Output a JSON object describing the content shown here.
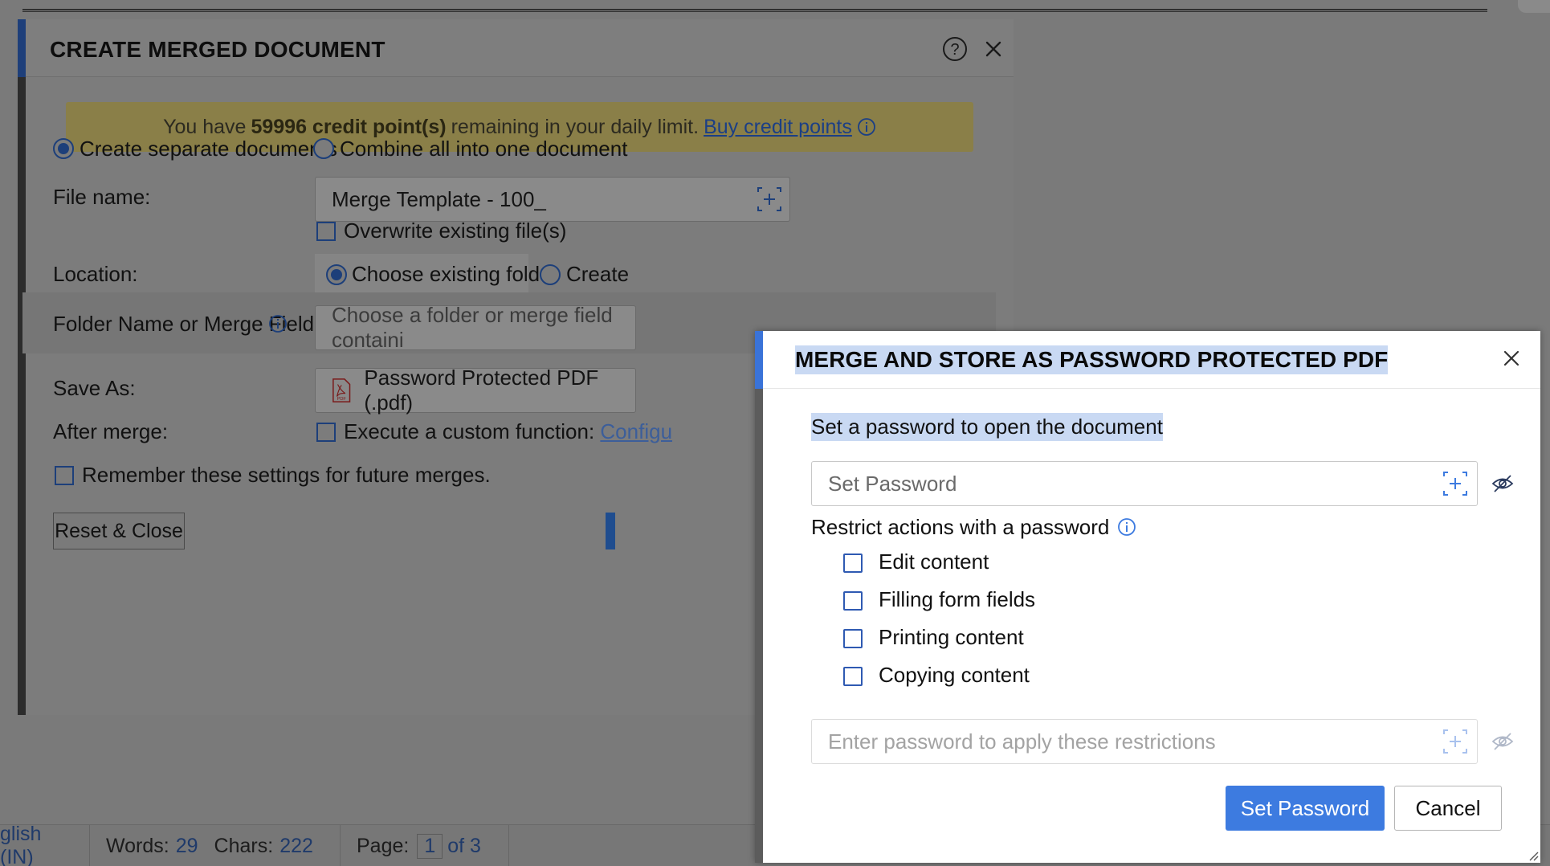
{
  "background": {
    "status_bar": {
      "language": "glish (IN)",
      "words_label": "Words:",
      "words_value": "29",
      "chars_label": "Chars:",
      "chars_value": "222",
      "page_label": "Page:",
      "page_current": "1",
      "page_total": "of 3"
    }
  },
  "merge_dialog": {
    "title": "CREATE MERGED DOCUMENT",
    "help_icon": "help-circle-icon",
    "close_icon": "close-icon",
    "credit": {
      "prefix": "You have",
      "points": "59996 credit point(s)",
      "suffix": "remaining in your daily limit.",
      "link": "Buy credit points",
      "info_icon": "info-icon"
    },
    "mode_options": [
      "Create separate documents",
      "Combine all into one document"
    ],
    "mode_selected": 0,
    "file_name_label": "File name:",
    "file_name_value": "Merge Template - 100_",
    "overwrite_label": "Overwrite existing file(s)",
    "location_label": "Location:",
    "location_options": [
      "Choose existing folder",
      "Create"
    ],
    "folder_label": "Folder Name or Merge Field:",
    "folder_placeholder": "Choose a folder or merge field containi",
    "save_as_label": "Save As:",
    "save_as_value": "Password Protected PDF (.pdf)",
    "after_merge_label": "After merge:",
    "execute_label": "Execute a custom function:",
    "configure_link": "Configu",
    "remember_label": "Remember these settings for future merges.",
    "reset_button": "Reset & Close"
  },
  "password_dialog": {
    "title": "MERGE AND STORE AS PASSWORD PROTECTED PDF",
    "open_password_label": "Set a password to open the document",
    "open_password_placeholder": "Set Password",
    "restrict_label": "Restrict actions with a password",
    "restrictions": [
      "Edit content",
      "Filling form fields",
      "Printing content",
      "Copying content"
    ],
    "restrict_password_placeholder": "Enter password to apply these restrictions",
    "set_password_button": "Set Password",
    "cancel_button": "Cancel"
  },
  "colors": {
    "accent_blue": "#3d7be0",
    "highlight": "#c9d9f3",
    "credit_banner": "#8a7f48"
  }
}
